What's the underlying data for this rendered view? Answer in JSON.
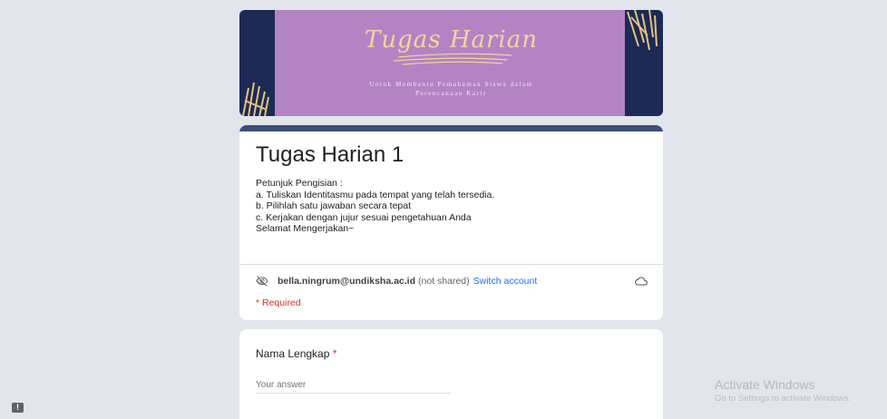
{
  "banner": {
    "title": "Tugas Harian",
    "subtitle_line1": "Untuk Membantu Pemahaman Siswa dalam",
    "subtitle_line2": "Perencanaan Karir"
  },
  "form": {
    "title": "Tugas Harian 1",
    "description": [
      "Petunjuk Pengisian :",
      "a. Tuliskan Identitasmu pada tempat yang telah tersedia.",
      "b. Pilihlah satu jawaban secara tepat",
      "c. Kerjakan dengan jujur sesuai pengetahuan Anda",
      "Selamat Mengerjakan~"
    ],
    "account_email": "bella.ningrum@undiksha.ac.id",
    "account_not_shared": "(not shared)",
    "switch_account": "Switch account",
    "required_note": "* Required"
  },
  "question": {
    "label": "Nama Lengkap",
    "required_star": "*",
    "placeholder": "Your answer"
  },
  "watermark": {
    "title": "Activate Windows",
    "subtitle": "Go to Settings to activate Windows."
  },
  "feedback": {
    "glyph": "!"
  },
  "colors": {
    "page_bg": "#e2e5ec",
    "banner_purple": "#b384c4",
    "banner_navy": "#1c2a55",
    "accent_bar": "#3f4e79",
    "link": "#1a73e8",
    "required": "#d93025"
  },
  "icons": {
    "privacy": "eye-off-icon",
    "cloud": "cloud-icon",
    "feedback": "feedback-icon"
  }
}
